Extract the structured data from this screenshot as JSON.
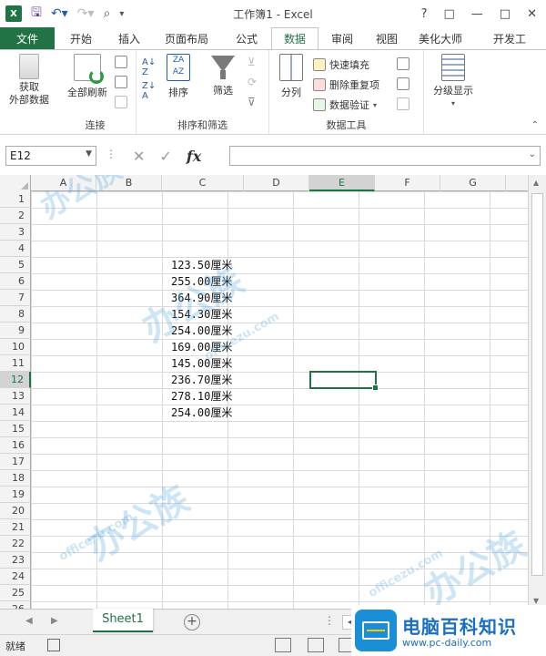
{
  "titlebar": {
    "app_icon": "X",
    "title": "工作簿1 - Excel",
    "controls": [
      "?",
      "□",
      "—",
      "□",
      "✕"
    ]
  },
  "tabs": [
    {
      "label": "文件",
      "active": false,
      "file": true
    },
    {
      "label": "开始",
      "active": false
    },
    {
      "label": "插入",
      "active": false
    },
    {
      "label": "页面布局",
      "active": false
    },
    {
      "label": "公式",
      "active": false
    },
    {
      "label": "数据",
      "active": true
    },
    {
      "label": "审阅",
      "active": false
    },
    {
      "label": "视图",
      "active": false
    },
    {
      "label": "美化大师",
      "active": false
    },
    {
      "label": "开发工",
      "active": false
    }
  ],
  "ribbon": {
    "get_external_line1": "获取",
    "get_external_line2": "外部数据",
    "refresh_all": "全部刷新",
    "group_connections": "连接",
    "sort": "排序",
    "filter": "筛选",
    "group_sort_filter": "排序和筛选",
    "split": "分列",
    "flash_fill": "快速填充",
    "remove_duplicates": "删除重复项",
    "data_validation": "数据验证",
    "group_data_tools": "数据工具",
    "outline": "分级显示"
  },
  "formula_bar": {
    "name_box": "E12",
    "fx": "fx",
    "value": ""
  },
  "grid": {
    "columns": [
      "A",
      "B",
      "C",
      "D",
      "E",
      "F",
      "G"
    ],
    "selected_column": "E",
    "rows": [
      "1",
      "2",
      "3",
      "4",
      "5",
      "6",
      "7",
      "8",
      "9",
      "10",
      "11",
      "12",
      "13",
      "14",
      "15",
      "16",
      "17",
      "18",
      "19",
      "20",
      "21",
      "22",
      "23",
      "24",
      "25",
      "26"
    ],
    "selected_row": "12",
    "cells_c": [
      {
        "row": 5,
        "value": "123.50",
        "unit": "厘米"
      },
      {
        "row": 6,
        "value": "255.00",
        "unit": "厘米"
      },
      {
        "row": 7,
        "value": "364.90",
        "unit": "厘米"
      },
      {
        "row": 8,
        "value": "154.30",
        "unit": "厘米"
      },
      {
        "row": 9,
        "value": "254.00",
        "unit": "厘米"
      },
      {
        "row": 10,
        "value": "169.00",
        "unit": "厘米"
      },
      {
        "row": 11,
        "value": "145.00",
        "unit": "厘米"
      },
      {
        "row": 12,
        "value": "236.70",
        "unit": "厘米"
      },
      {
        "row": 13,
        "value": "278.10",
        "unit": "厘米"
      },
      {
        "row": 14,
        "value": "254.00",
        "unit": "厘米"
      }
    ]
  },
  "sheets": {
    "active": "Sheet1",
    "add": "+"
  },
  "status": {
    "ready": "就绪"
  },
  "brand": {
    "title": "电脑百科知识",
    "url": "www.pc-daily.com"
  },
  "watermark": {
    "text": "办公族",
    "site": "officezu.com"
  },
  "colors": {
    "excel_green": "#217346",
    "brand_blue": "#1a8fd6"
  }
}
